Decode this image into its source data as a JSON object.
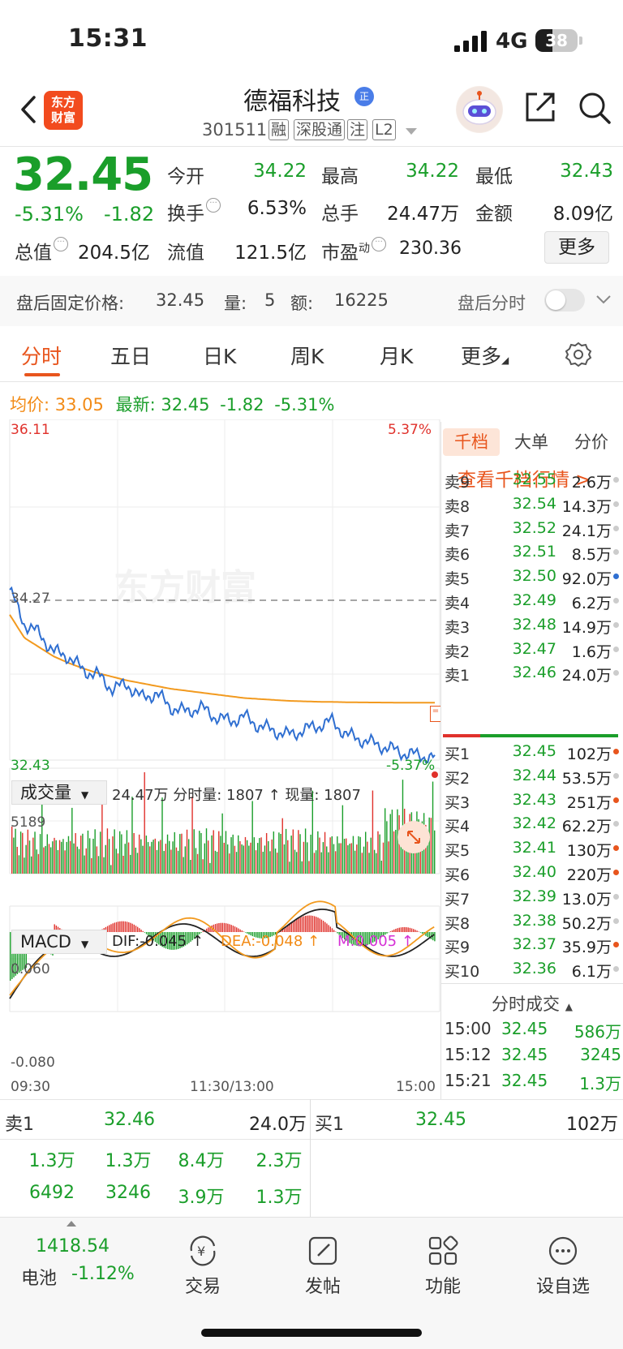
{
  "status_bar": {
    "time": "15:31",
    "network": "4G",
    "battery": "38"
  },
  "header": {
    "logo": "东方财富",
    "stock_name": "德福科技",
    "badge": "正",
    "stock_code": "301511",
    "tags": [
      "融",
      "深股通",
      "注",
      "L2"
    ]
  },
  "quote": {
    "price": "32.45",
    "change_pct": "-5.31%",
    "change": "-1.82",
    "fields": [
      {
        "label": "今开",
        "value": "34.22",
        "color": "#1a9e2a"
      },
      {
        "label": "最高",
        "value": "34.22",
        "color": "#1a9e2a"
      },
      {
        "label": "最低",
        "value": "32.43",
        "color": "#1a9e2a"
      },
      {
        "label": "换手",
        "value": "6.53%",
        "color": "#222222"
      },
      {
        "label": "总手",
        "value": "24.47万",
        "color": "#222222"
      },
      {
        "label": "金额",
        "value": "8.09亿",
        "color": "#222222"
      },
      {
        "label": "总值",
        "value": "204.5亿",
        "color": "#222222"
      },
      {
        "label": "流值",
        "value": "121.5亿",
        "color": "#222222"
      },
      {
        "label": "市盈",
        "superscript": "动",
        "value": "230.36",
        "color": "#222222"
      }
    ],
    "more_button": "更多"
  },
  "after_hours": {
    "label": "盘后固定价格:",
    "price": "32.45",
    "vol_label": "量:",
    "vol": "5",
    "amt_label": "额:",
    "amt": "16225",
    "toggle_label": "盘后分时",
    "toggle_on": false
  },
  "tabs": [
    "分时",
    "五日",
    "日K",
    "周K",
    "月K",
    "更多"
  ],
  "active_tab": "分时",
  "info_line": {
    "avg_label": "均价:",
    "avg": "33.05",
    "latest_label": "最新:",
    "latest": "32.45",
    "change": "-1.82",
    "change_pct": "-5.31%"
  },
  "chart_labels": {
    "top_price": "36.11",
    "top_pct": "5.37%",
    "ref_price": "34.27",
    "bottom_price": "32.43",
    "bottom_pct": "-5.37%",
    "watermark": "东方财富",
    "volume_selector": "成交量",
    "volume_info": "24.47万 分时量: 1807 ↑ 现量: 1807",
    "volume_max": "5189",
    "macd_selector": "MACD",
    "dif": "DIF:-0.045 ↑",
    "dea": "DEA:-0.048 ↑",
    "m": "M:0.005 ↑",
    "macd_top": "0.060",
    "macd_bottom": "-0.080",
    "time_start": "09:30",
    "time_mid": "11:30/13:00",
    "time_end": "15:00"
  },
  "chart_data": [
    {
      "type": "line",
      "title": "",
      "x_range": [
        "09:30",
        "15:00"
      ],
      "ylim": [
        32.43,
        36.11
      ],
      "reference": 34.27,
      "series": [
        {
          "name": "最新",
          "color": "#2f6fd1",
          "values": [
            34.27,
            33.9,
            33.8,
            33.6,
            33.55,
            33.4,
            33.35,
            33.2,
            33.25,
            33.1,
            33.15,
            33.0,
            32.95,
            33.0,
            32.9,
            32.85,
            32.9,
            32.8,
            32.75,
            32.7,
            32.75,
            32.8,
            32.85,
            32.7,
            32.65,
            32.6,
            32.55,
            32.5,
            32.48,
            32.45
          ]
        },
        {
          "name": "均价",
          "color": "#f29a1f",
          "values": [
            34.0,
            33.75,
            33.65,
            33.55,
            33.48,
            33.42,
            33.37,
            33.33,
            33.29,
            33.26,
            33.23,
            33.2,
            33.18,
            33.16,
            33.14,
            33.12,
            33.1,
            33.09,
            33.08,
            33.07,
            33.065,
            33.06,
            33.058,
            33.055,
            33.053,
            33.052,
            33.051,
            33.05,
            33.05,
            33.05
          ]
        }
      ]
    }
  ],
  "right_panel": {
    "tabs": [
      "千档",
      "大单",
      "分价"
    ],
    "active_tab": "千档",
    "link": "查看千档行情 >",
    "asks": [
      {
        "label": "卖9",
        "price": "32.55",
        "vol": "2.6万",
        "dot": "#cccccc"
      },
      {
        "label": "卖8",
        "price": "32.54",
        "vol": "14.3万",
        "dot": "#cccccc"
      },
      {
        "label": "卖7",
        "price": "32.52",
        "vol": "24.1万",
        "dot": "#cccccc"
      },
      {
        "label": "卖6",
        "price": "32.51",
        "vol": "8.5万",
        "dot": "#cccccc"
      },
      {
        "label": "卖5",
        "price": "32.50",
        "vol": "92.0万",
        "dot": "#2f6fd1"
      },
      {
        "label": "卖4",
        "price": "32.49",
        "vol": "6.2万",
        "dot": "#cccccc"
      },
      {
        "label": "卖3",
        "price": "32.48",
        "vol": "14.9万",
        "dot": "#cccccc"
      },
      {
        "label": "卖2",
        "price": "32.47",
        "vol": "1.6万",
        "dot": "#cccccc"
      },
      {
        "label": "卖1",
        "price": "32.46",
        "vol": "24.0万",
        "dot": "#cccccc"
      }
    ],
    "bids": [
      {
        "label": "买1",
        "price": "32.45",
        "vol": "102万",
        "dot": "#e8551d"
      },
      {
        "label": "买2",
        "price": "32.44",
        "vol": "53.5万",
        "dot": "#cccccc"
      },
      {
        "label": "买3",
        "price": "32.43",
        "vol": "251万",
        "dot": "#e8551d"
      },
      {
        "label": "买4",
        "price": "32.42",
        "vol": "62.2万",
        "dot": "#cccccc"
      },
      {
        "label": "买5",
        "price": "32.41",
        "vol": "130万",
        "dot": "#e8551d"
      },
      {
        "label": "买6",
        "price": "32.40",
        "vol": "220万",
        "dot": "#e8551d"
      },
      {
        "label": "买7",
        "price": "32.39",
        "vol": "13.0万",
        "dot": "#cccccc"
      },
      {
        "label": "买8",
        "price": "32.38",
        "vol": "50.2万",
        "dot": "#cccccc"
      },
      {
        "label": "买9",
        "price": "32.37",
        "vol": "35.9万",
        "dot": "#e8551d"
      },
      {
        "label": "买10",
        "price": "32.36",
        "vol": "6.1万",
        "dot": "#cccccc"
      }
    ],
    "ticks_title": "分时成交",
    "ticks": [
      {
        "time": "15:00",
        "price": "32.45",
        "vol": "586万"
      },
      {
        "time": "15:12",
        "price": "32.45",
        "vol": "3245"
      },
      {
        "time": "15:21",
        "price": "32.45",
        "vol": "1.3万"
      }
    ]
  },
  "queue": {
    "ask_label": "卖1",
    "ask_price": "32.46",
    "ask_vol": "24.0万",
    "bid_label": "买1",
    "bid_price": "32.45",
    "bid_vol": "102万",
    "ask_orders": [
      "1.3万",
      "1.3万",
      "8.4万",
      "2.3万",
      "6492",
      "3246",
      "3.9万",
      "1.3万"
    ]
  },
  "bottom_nav": {
    "index_value": "1418.54",
    "index_name": "电池",
    "index_change": "-1.12%",
    "items": [
      "交易",
      "发帖",
      "功能",
      "设自选"
    ]
  }
}
